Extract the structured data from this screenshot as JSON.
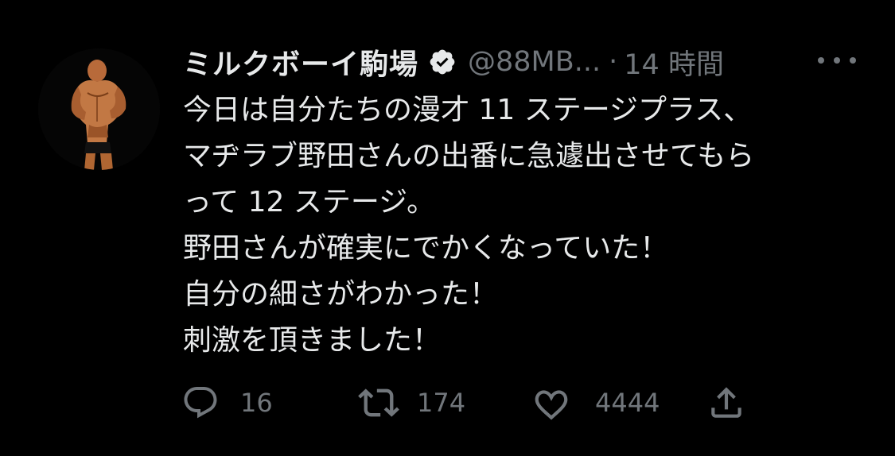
{
  "tweet": {
    "display_name": "ミルクボーイ駒場",
    "verified_icon": "verified-badge-icon",
    "handle": "@88MB...",
    "separator": "·",
    "time": "14 時間",
    "more_icon": "more-options-icon",
    "body_lines": [
      "今日は自分たちの漫才 11 ステージプラス、",
      "マヂラブ野田さんの出番に急遽出させてもら",
      "って 12 ステージ。",
      "野田さんが確実にでかくなっていた！",
      "自分の細さがわかった！",
      "刺激を頂きました！"
    ],
    "actions": {
      "reply": {
        "icon": "reply-icon",
        "count": "16"
      },
      "retweet": {
        "icon": "retweet-icon",
        "count": "174"
      },
      "like": {
        "icon": "heart-icon",
        "count": "4444"
      },
      "share": {
        "icon": "share-icon"
      }
    }
  },
  "colors": {
    "background": "#000000",
    "text": "#e7e9ea",
    "muted": "#71767b"
  }
}
